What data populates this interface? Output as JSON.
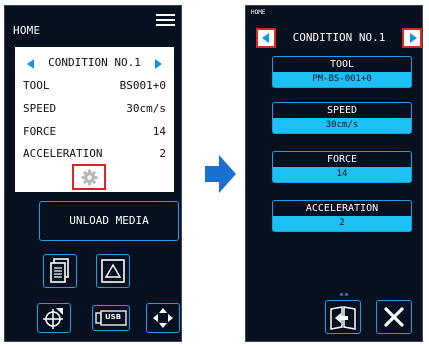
{
  "left_screen": {
    "title": "HOME",
    "condition_title": "CONDITION NO.1",
    "params": [
      {
        "label": "TOOL",
        "value": "BS001+0"
      },
      {
        "label": "SPEED",
        "value": "30cm/s"
      },
      {
        "label": "FORCE",
        "value": "14"
      },
      {
        "label": "ACCELERATION",
        "value": "2"
      }
    ],
    "unload_button": "UNLOAD MEDIA",
    "usb_label": "USB"
  },
  "right_screen": {
    "home_label": "HOME",
    "condition_title": "CONDITION NO.1",
    "fields": [
      {
        "label": "TOOL",
        "value": "PM-BS-001+0"
      },
      {
        "label": "SPEED",
        "value": "30cm/s"
      },
      {
        "label": "FORCE",
        "value": "14"
      },
      {
        "label": "ACCELERATION",
        "value": "2"
      }
    ]
  },
  "colors": {
    "accent": "#1f9ee8",
    "value_bg": "#1cc0f4",
    "highlight": "#e02424",
    "flow_arrow": "#1a6fcf",
    "screen_bg": "#07101f"
  },
  "icons": {
    "left": [
      "menu-icon",
      "gear-icon",
      "document-icon",
      "triangle-icon",
      "origin-crosshair-icon",
      "usb-icon",
      "move-arrows-icon"
    ],
    "right": [
      "book-return-icon",
      "close-icon"
    ],
    "between": "flow-arrow-icon"
  }
}
